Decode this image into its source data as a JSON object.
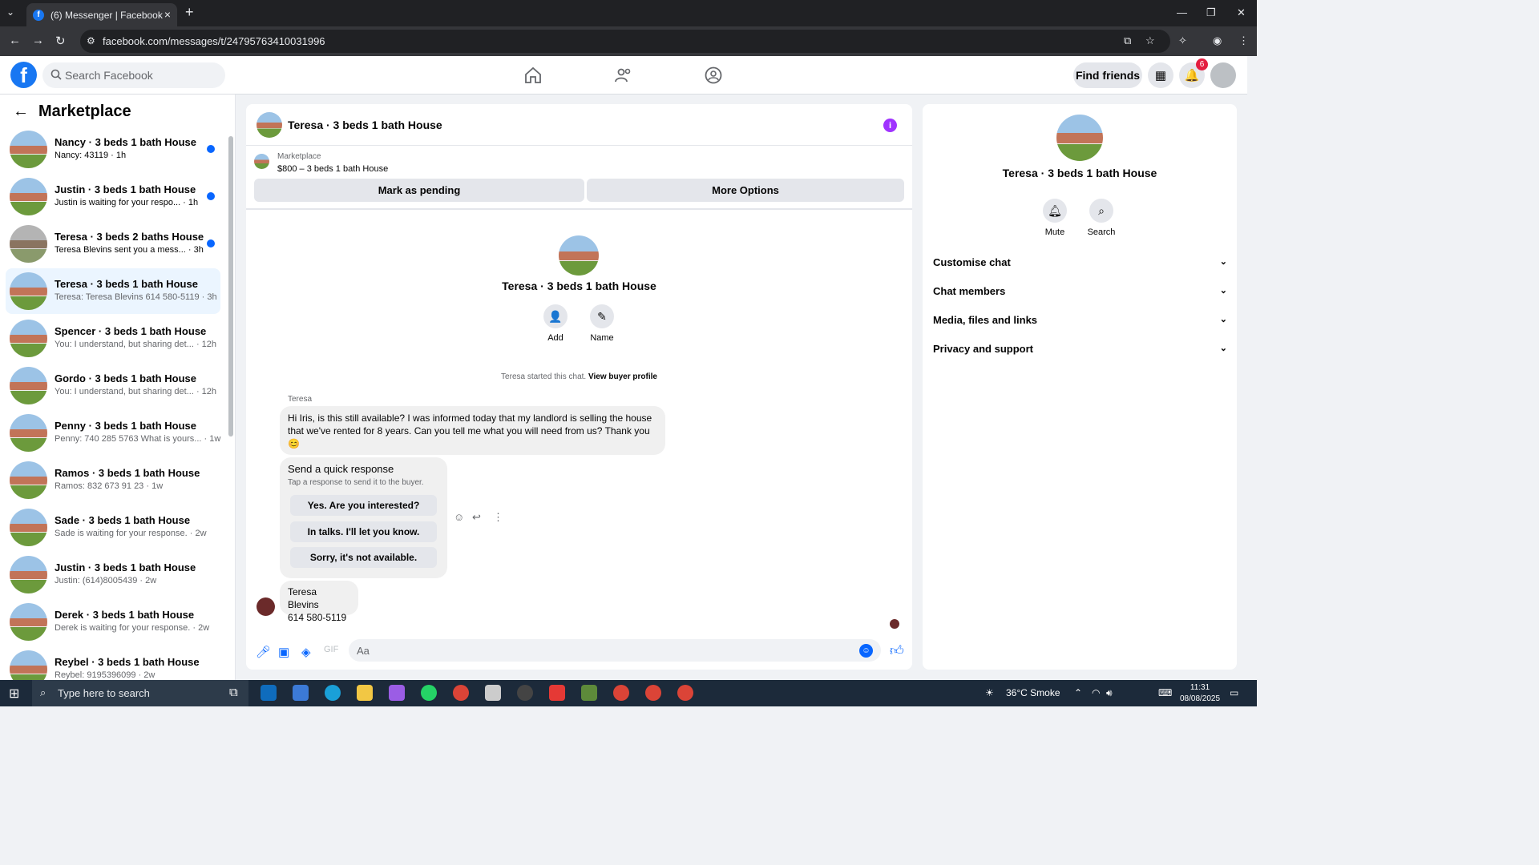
{
  "browser": {
    "tab_title": "(6) Messenger | Facebook",
    "url": "facebook.com/messages/t/24795763410031996"
  },
  "header": {
    "search_placeholder": "Search Facebook",
    "find_friends": "Find friends",
    "notification_count": "6"
  },
  "sidebar": {
    "title": "Marketplace",
    "conversations": [
      {
        "title": "Nancy · 3 beds 1 bath House",
        "subtitle": "Nancy: 43119 · 1h",
        "unread": true
      },
      {
        "title": "Justin · 3 beds 1 bath House",
        "subtitle": "Justin is waiting for your respo... · 1h",
        "unread": true
      },
      {
        "title": "Teresa · 3 beds 2 baths House",
        "subtitle": "Teresa Blevins sent you a mess... · 3h",
        "unread": true
      },
      {
        "title": "Teresa · 3 beds 1 bath House",
        "subtitle": "Teresa: Teresa Blevins 614 580-5119 · 3h",
        "unread": false,
        "active": true
      },
      {
        "title": "Spencer · 3 beds 1 bath House",
        "subtitle": "You: I understand, but sharing det... · 12h",
        "unread": false
      },
      {
        "title": "Gordo · 3 beds 1 bath House",
        "subtitle": "You: I understand, but sharing det... · 12h",
        "unread": false
      },
      {
        "title": "Penny · 3 beds 1 bath House",
        "subtitle": "Penny: 740 285 5763 What is yours... · 1w",
        "unread": false
      },
      {
        "title": "Ramos · 3 beds 1 bath House",
        "subtitle": "Ramos: 832 673 91 23 · 1w",
        "unread": false
      },
      {
        "title": "Sade · 3 beds 1 bath House",
        "subtitle": "Sade is waiting for your response. · 2w",
        "unread": false
      },
      {
        "title": "Justin · 3 beds 1 bath House",
        "subtitle": "Justin: (614)8005439 · 2w",
        "unread": false
      },
      {
        "title": "Derek · 3 beds 1 bath House",
        "subtitle": "Derek is waiting for your response. · 2w",
        "unread": false
      },
      {
        "title": "Reybel · 3 beds 1 bath House",
        "subtitle": "Reybel: 9195396099 · 2w",
        "unread": false
      }
    ]
  },
  "chat": {
    "title": "Teresa · 3 beds 1 bath House",
    "listing_category": "Marketplace",
    "listing_price": "$800 – 3 beds 1 bath House",
    "mark_pending": "Mark as pending",
    "more_options": "More Options",
    "intro_title": "Teresa · 3 beds 1 bath House",
    "add_label": "Add",
    "name_label": "Name",
    "started_text": "Teresa started this chat.",
    "view_profile": "View buyer profile",
    "sender": "Teresa",
    "message1": "Hi Iris, is this still available? I was informed today that my landlord is selling the house that we've rented for 8 years. Can you tell me what you will need from us? Thank you 😊",
    "quick_title": "Send a quick response",
    "quick_sub": "Tap a response to send it to the buyer.",
    "quick_options": [
      "Yes. Are you interested?",
      "In talks. I'll let you know.",
      "Sorry, it's not available."
    ],
    "message2_line1": "Teresa Blevins",
    "message2_line2": "614 580-5119",
    "composer_placeholder": "Aa"
  },
  "details": {
    "title": "Teresa · 3 beds 1 bath House",
    "mute": "Mute",
    "search": "Search",
    "sections": [
      "Customise chat",
      "Chat members",
      "Media, files and links",
      "Privacy and support"
    ]
  },
  "taskbar": {
    "search_placeholder": "Type here to search",
    "weather": "36°C  Smoke",
    "time": "11:31",
    "date": "08/08/2025"
  }
}
